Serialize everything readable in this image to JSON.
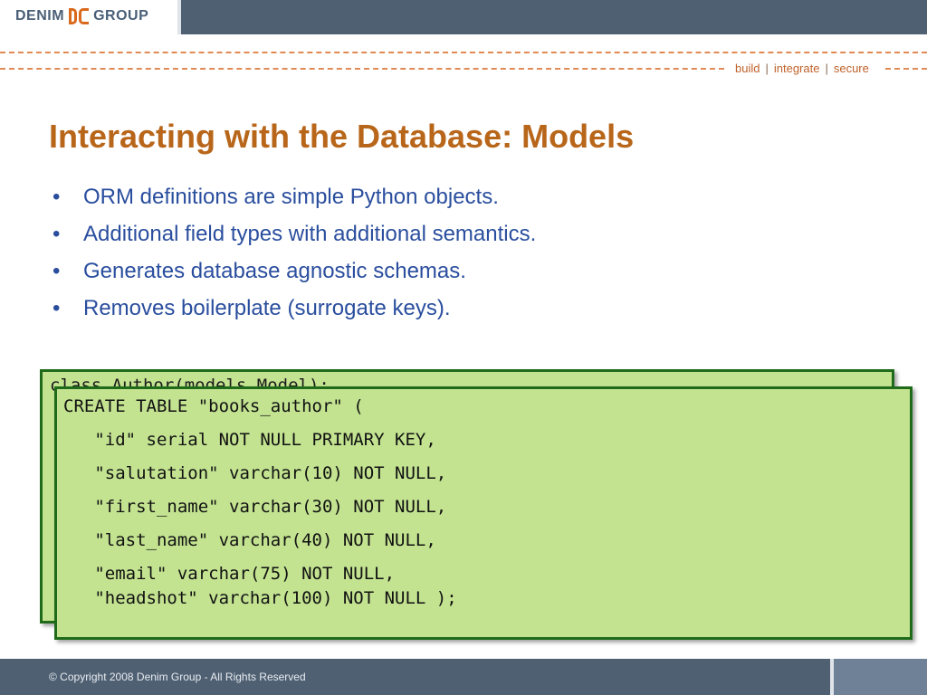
{
  "header": {
    "logo_left": "DENIM",
    "logo_right": "GROUP",
    "tagline": [
      "build",
      "integrate",
      "secure"
    ]
  },
  "slide": {
    "title": "Interacting with the Database: Models",
    "bullets": [
      "ORM definitions are simple Python objects.",
      "Additional field types with additional semantics.",
      "Generates database agnostic schemas.",
      "Removes boilerplate (surrogate keys)."
    ],
    "bullet_glyph": "•"
  },
  "code_back": {
    "visible_line": "class Author(models.Model):"
  },
  "code_front": {
    "lines": [
      "CREATE TABLE \"books_author\" (",
      "   \"id\" serial NOT NULL PRIMARY KEY,",
      "   \"salutation\" varchar(10) NOT NULL,",
      "   \"first_name\" varchar(30) NOT NULL,",
      "   \"last_name\" varchar(40) NOT NULL,",
      "   \"email\" varchar(75) NOT NULL,",
      "   \"headshot\" varchar(100) NOT NULL );"
    ]
  },
  "footer": {
    "copyright": "© Copyright 2008 Denim Group - All Rights Reserved"
  },
  "colors": {
    "header_bg": "#4f6073",
    "title": "#b8661a",
    "bullet_text": "#2a4e9e",
    "code_bg": "#c3e391",
    "code_border": "#1f6b1a",
    "accent_orange": "#d96a1e"
  }
}
